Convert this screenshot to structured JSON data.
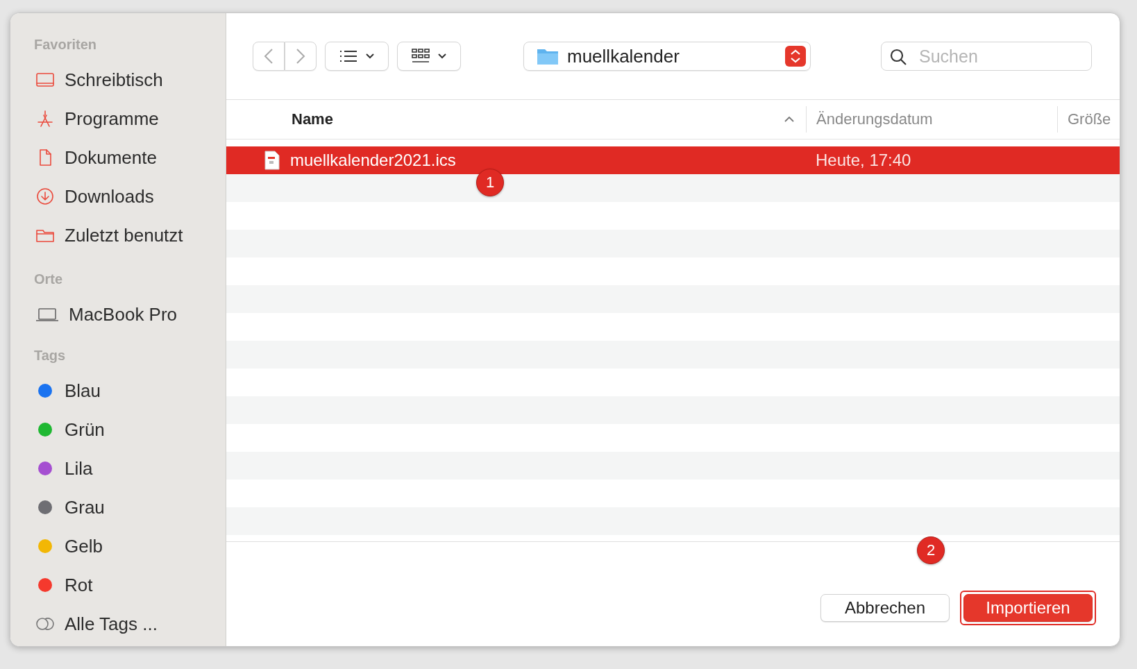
{
  "sidebar": {
    "sections": [
      {
        "title": "Favoriten",
        "items": [
          {
            "label": "Schreibtisch",
            "kind": "desktop"
          },
          {
            "label": "Programme",
            "kind": "apps"
          },
          {
            "label": "Dokumente",
            "kind": "document"
          },
          {
            "label": "Downloads",
            "kind": "download"
          },
          {
            "label": "Zuletzt benutzt",
            "kind": "folder"
          }
        ]
      },
      {
        "title": "Orte",
        "items": [
          {
            "label": "MacBook Pro",
            "kind": "laptop"
          }
        ]
      },
      {
        "title": "Tags",
        "items": [
          {
            "label": "Blau",
            "kind": "tag",
            "color": "#1a73f0"
          },
          {
            "label": "Grün",
            "kind": "tag",
            "color": "#1fb832"
          },
          {
            "label": "Lila",
            "kind": "tag",
            "color": "#a54fd1"
          },
          {
            "label": "Grau",
            "kind": "tag",
            "color": "#6e6e73"
          },
          {
            "label": "Gelb",
            "kind": "tag",
            "color": "#f2b705"
          },
          {
            "label": "Rot",
            "kind": "tag",
            "color": "#f5392d"
          },
          {
            "label": "Alle Tags ...",
            "kind": "all-tags"
          }
        ]
      }
    ]
  },
  "toolbar": {
    "location": "muellkalender",
    "search": {
      "placeholder": "Suchen"
    }
  },
  "table": {
    "columns": [
      {
        "label": "Name",
        "sorted": true
      },
      {
        "label": "Änderungsdatum",
        "sorted": false
      },
      {
        "label": "Größe",
        "sorted": false
      }
    ],
    "rows": [
      {
        "name": "muellkalender2021.ics",
        "date": "Heute, 17:40",
        "selected": true
      }
    ]
  },
  "buttons": [
    {
      "label": "Abbrechen",
      "kind": "secondary",
      "highlighted": false
    },
    {
      "label": "Importieren",
      "kind": "primary",
      "highlighted": true
    }
  ],
  "annotations": {
    "row_marker": "1",
    "button_marker": "2"
  }
}
